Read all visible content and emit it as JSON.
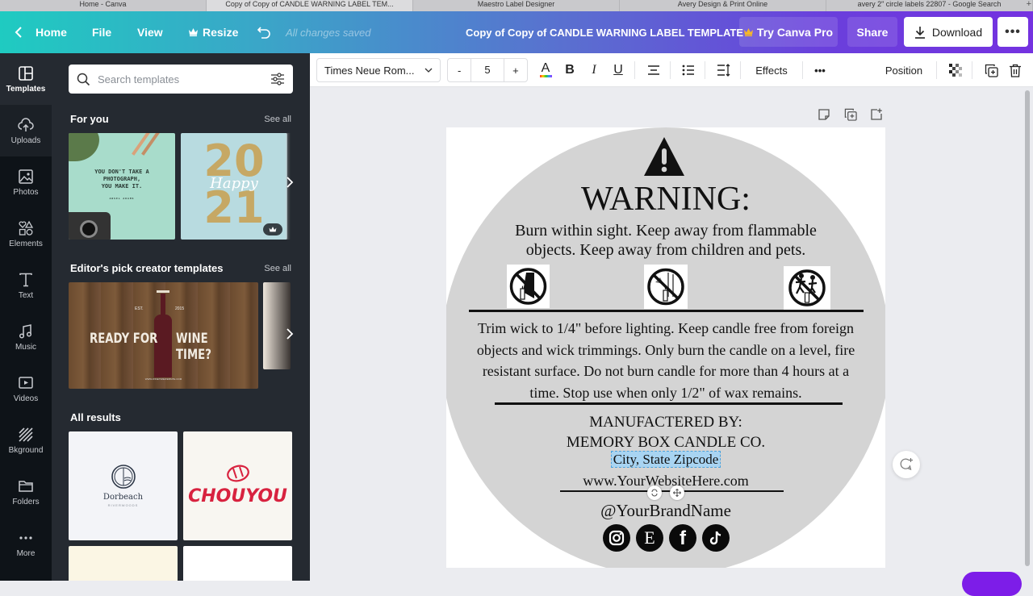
{
  "browser_tabs": [
    {
      "label": "Home - Canva",
      "active": false
    },
    {
      "label": "Copy of Copy of CANDLE WARNING LABEL TEM...",
      "active": true
    },
    {
      "label": "Maestro Label Designer",
      "active": false
    },
    {
      "label": "Avery Design & Print Online",
      "active": false
    },
    {
      "label": "avery 2\" circle labels 22807 - Google Search",
      "active": false
    }
  ],
  "header": {
    "home": "Home",
    "file": "File",
    "view": "View",
    "resize": "Resize",
    "save_status": "All changes saved",
    "doc_title": "Copy of Copy of CANDLE WARNING LABEL TEMPLATE",
    "try_pro": "Try Canva Pro",
    "share": "Share",
    "download": "Download",
    "more": "•••"
  },
  "rail": {
    "items": [
      {
        "label": "Templates",
        "icon": "templates-icon",
        "active": true
      },
      {
        "label": "Uploads",
        "icon": "upload-cloud-icon",
        "active": false
      },
      {
        "label": "Photos",
        "icon": "photo-icon",
        "active": false
      },
      {
        "label": "Elements",
        "icon": "shapes-icon",
        "active": false
      },
      {
        "label": "Text",
        "icon": "text-icon",
        "active": false
      },
      {
        "label": "Music",
        "icon": "music-icon",
        "active": false
      },
      {
        "label": "Videos",
        "icon": "video-icon",
        "active": false
      },
      {
        "label": "Bkground",
        "icon": "background-icon",
        "active": false
      },
      {
        "label": "Folders",
        "icon": "folder-icon",
        "active": false
      },
      {
        "label": "More",
        "icon": "more-dots-icon",
        "active": false
      }
    ]
  },
  "panel": {
    "search_placeholder": "Search templates",
    "for_you": {
      "title": "For you",
      "see_all": "See all"
    },
    "for_you_cards": [
      {
        "text_lines": [
          "YOU DON'T TAKE A",
          "PHOTOGRAPH,",
          "YOU MAKE IT."
        ],
        "byline": "ANSEL ADAMS"
      },
      {
        "text_lines": [
          "20",
          "21"
        ],
        "script": "Happy",
        "pro": true
      }
    ],
    "editors_pick": {
      "title": "Editor's pick creator templates",
      "see_all": "See all"
    },
    "editors_card": {
      "left": "READY FOR",
      "right": "WINE TIME?",
      "est": "EST.",
      "year": "2015",
      "url": "WWW.WINETIMEWEBSITE.COM"
    },
    "all_results": {
      "title": "All results"
    },
    "results": [
      {
        "name": "Dorbeach",
        "sub": "RIVERWOODS"
      },
      {
        "name": "CHOUYOU"
      }
    ]
  },
  "toolbar": {
    "font": "Times Neue Rom...",
    "size_minus": "-",
    "font_size": "5",
    "size_plus": "+",
    "text_color_glyph": "A",
    "bold": "B",
    "italic": "I",
    "underline": "U",
    "effects": "Effects",
    "more": "•••",
    "position": "Position"
  },
  "label": {
    "heading": "WARNING:",
    "intro": [
      "Burn within sight. Keep away from flammable",
      "objects. Keep away from children and pets."
    ],
    "icons": [
      "no-candle-near-curtains-icon",
      "no-candle-near-flammables-icon",
      "no-candle-near-children-icon"
    ],
    "instructions": [
      "Trim wick to 1/4\" before lighting. Keep candle free from foreign",
      "objects and wick trimmings. Only burn the candle on a level, fire",
      "resistant surface. Do not burn candle for more than 4 hours at a",
      "time. Stop use when only 1/2\" of wax remains."
    ],
    "manufactured_by": "MANUFACTERED BY:",
    "company": "MEMORY BOX CANDLE CO.",
    "city": "City, State Zipcode",
    "website": "www.YourWebsiteHere.com",
    "handle": "@YourBrandName",
    "socials": [
      "instagram",
      "etsy",
      "facebook",
      "tiktok"
    ],
    "etsy_glyph": "E",
    "facebook_glyph": "f"
  },
  "colors": {
    "accent": "#7d2ae8",
    "selection": "#a8d4f2",
    "label_bg": "#d4d4d4"
  }
}
